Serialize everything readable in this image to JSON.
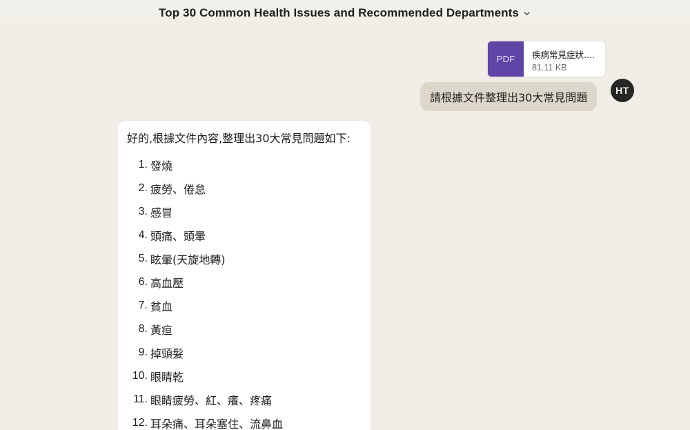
{
  "header": {
    "title": "Top 30 Common Health Issues and Recommended Departments",
    "dropdown_icon": "chevron-down-icon"
  },
  "attachment": {
    "type_label": "PDF",
    "file_name": "疾病常見症狀....",
    "file_size": "81.11 KB",
    "type_color": "#5e45a6"
  },
  "user_message": {
    "text": "請根據文件整理出30大常見問題",
    "avatar_initials": "HT"
  },
  "assistant_message": {
    "intro": "好的,根據文件內容,整理出30大常見問題如下:",
    "items": [
      {
        "num": "1.",
        "text": "發燒"
      },
      {
        "num": "2.",
        "text": "疲勞、倦怠"
      },
      {
        "num": "3.",
        "text": "感冒"
      },
      {
        "num": "4.",
        "text": "頭痛、頭暈"
      },
      {
        "num": "5.",
        "text": "眩暈(天旋地轉)"
      },
      {
        "num": "6.",
        "text": "高血壓"
      },
      {
        "num": "7.",
        "text": "貧血"
      },
      {
        "num": "8.",
        "text": "黃疸"
      },
      {
        "num": "9.",
        "text": "掉頭髮"
      },
      {
        "num": "10.",
        "text": "眼睛乾"
      },
      {
        "num": "11.",
        "text": "眼睛疲勞、紅、癢、疼痛"
      },
      {
        "num": "12.",
        "text": "耳朵痛、耳朵塞住、流鼻血"
      }
    ]
  },
  "colors": {
    "background": "#f0ede6",
    "user_bubble": "#ddd7cb",
    "avatar": "#262624",
    "card": "#ffffff"
  }
}
